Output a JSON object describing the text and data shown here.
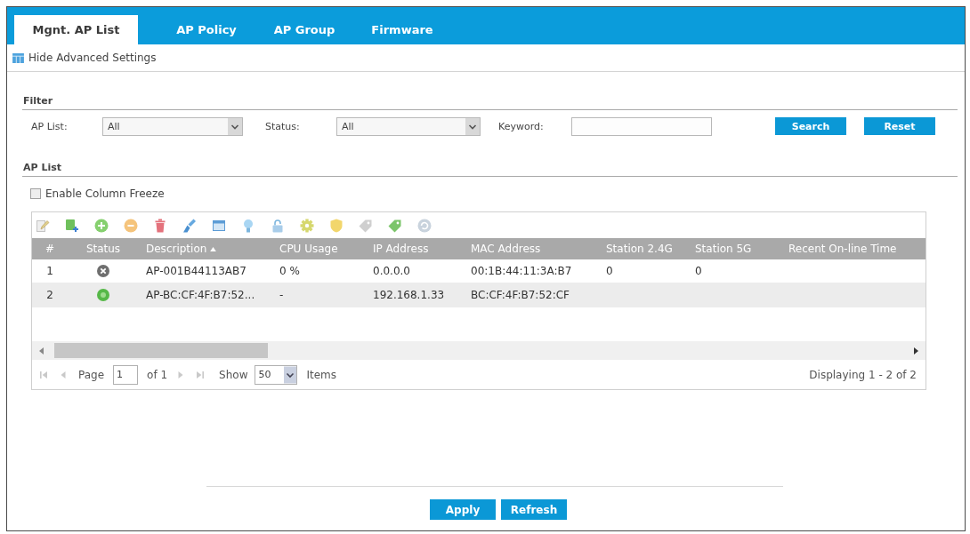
{
  "tabs": [
    {
      "label": "Mgnt. AP List",
      "selected": true
    },
    {
      "label": "AP Policy",
      "selected": false
    },
    {
      "label": "AP Group",
      "selected": false
    },
    {
      "label": "Firmware",
      "selected": false
    }
  ],
  "advanced_link": {
    "label": "Hide Advanced Settings"
  },
  "filter": {
    "title": "Filter",
    "ap_list": {
      "label": "AP List:",
      "value": "All"
    },
    "status": {
      "label": "Status:",
      "value": "All"
    },
    "keyword": {
      "label": "Keyword:"
    },
    "buttons": [
      "Search",
      "Reset"
    ]
  },
  "ap_list": {
    "title": "AP List",
    "column_freeze": {
      "label": "Enable Column Freeze",
      "checked": false
    },
    "columns": [
      {
        "label": "#",
        "sorted_ascending": false
      },
      {
        "label": "Status",
        "sorted_ascending": false
      },
      {
        "label": "Description",
        "sorted_ascending": true
      },
      {
        "label": "CPU Usage",
        "sorted_ascending": false
      },
      {
        "label": "IP Address",
        "sorted_ascending": false
      },
      {
        "label": "MAC Address",
        "sorted_ascending": false
      },
      {
        "label": "Station 2.4G",
        "sorted_ascending": false
      },
      {
        "label": "Station 5G",
        "sorted_ascending": false
      },
      {
        "label": "Recent On-line Time",
        "sorted_ascending": false
      }
    ],
    "rows": [
      {
        "number": "1",
        "online": false,
        "description": "AP-001B44113AB7",
        "cpu_usage": "0 %",
        "ip_address": "0.0.0.0",
        "mac_address": "00:1B:44:11:3A:B7",
        "station_2_4g": "0",
        "station_5g": "0"
      },
      {
        "number": "2",
        "online": true,
        "description": "AP-BC:CF:4F:B7:52...",
        "cpu_usage": "-",
        "ip_address": "192.168.1.33",
        "mac_address": "BC:CF:4F:B7:52:CF"
      }
    ],
    "pager": {
      "nav": [
        {
          "kind": "first",
          "disabled": true
        },
        {
          "kind": "prev",
          "disabled": true
        },
        {
          "kind": "next",
          "disabled": true
        },
        {
          "kind": "last",
          "disabled": true
        }
      ],
      "page_label": "Page",
      "page": "1",
      "total": "of 1",
      "show_label": "Show",
      "per_page": "50",
      "items_label": "Items",
      "summary": "Displaying 1 - 2 of 2"
    }
  },
  "buttons": [
    "Apply",
    "Refresh"
  ]
}
